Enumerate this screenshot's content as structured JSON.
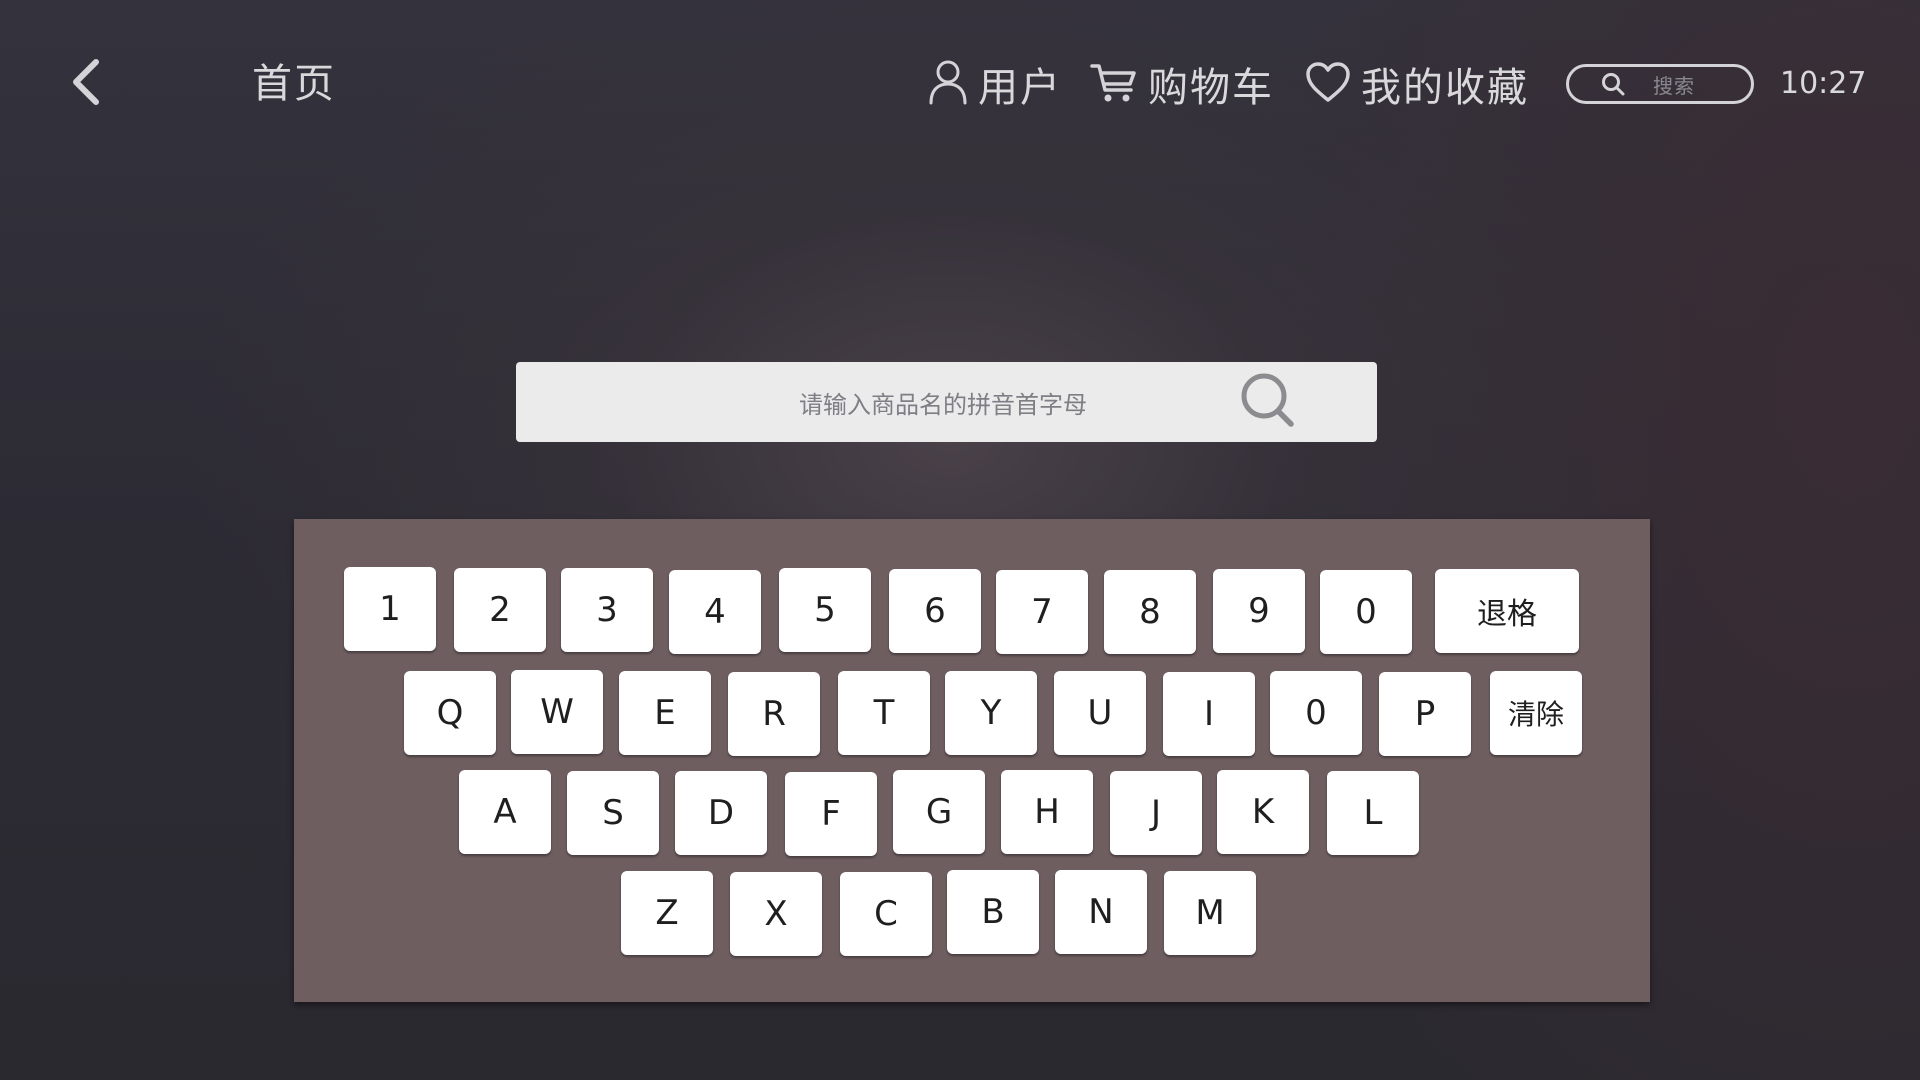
{
  "header": {
    "back_icon": "chevron-left-icon",
    "title": "首页",
    "nav": [
      {
        "id": "user",
        "icon": "user-icon",
        "label": "用户"
      },
      {
        "id": "cart",
        "icon": "cart-icon",
        "label": "购物车"
      },
      {
        "id": "favorites",
        "icon": "heart-icon",
        "label": "我的收藏"
      }
    ],
    "search": {
      "icon": "search-icon",
      "placeholder": "搜索"
    },
    "time": "10:27"
  },
  "main_search": {
    "placeholder": "请输入商品名的拼音首字母",
    "icon": "search-icon"
  },
  "keyboard": {
    "rows": [
      [
        "1",
        "2",
        "3",
        "4",
        "5",
        "6",
        "7",
        "8",
        "9",
        "0",
        "退格"
      ],
      [
        "Q",
        "W",
        "E",
        "R",
        "T",
        "Y",
        "U",
        "I",
        "0",
        "P",
        "清除"
      ],
      [
        "A",
        "S",
        "D",
        "F",
        "G",
        "H",
        "J",
        "K",
        "L"
      ],
      [
        "Z",
        "X",
        "C",
        "B",
        "N",
        "M"
      ]
    ]
  },
  "colors": {
    "keyboard_bg": "#6e5e60",
    "key_bg": "#ffffff",
    "search_bg": "#ebebec",
    "header_text": "#d9d9dc"
  }
}
